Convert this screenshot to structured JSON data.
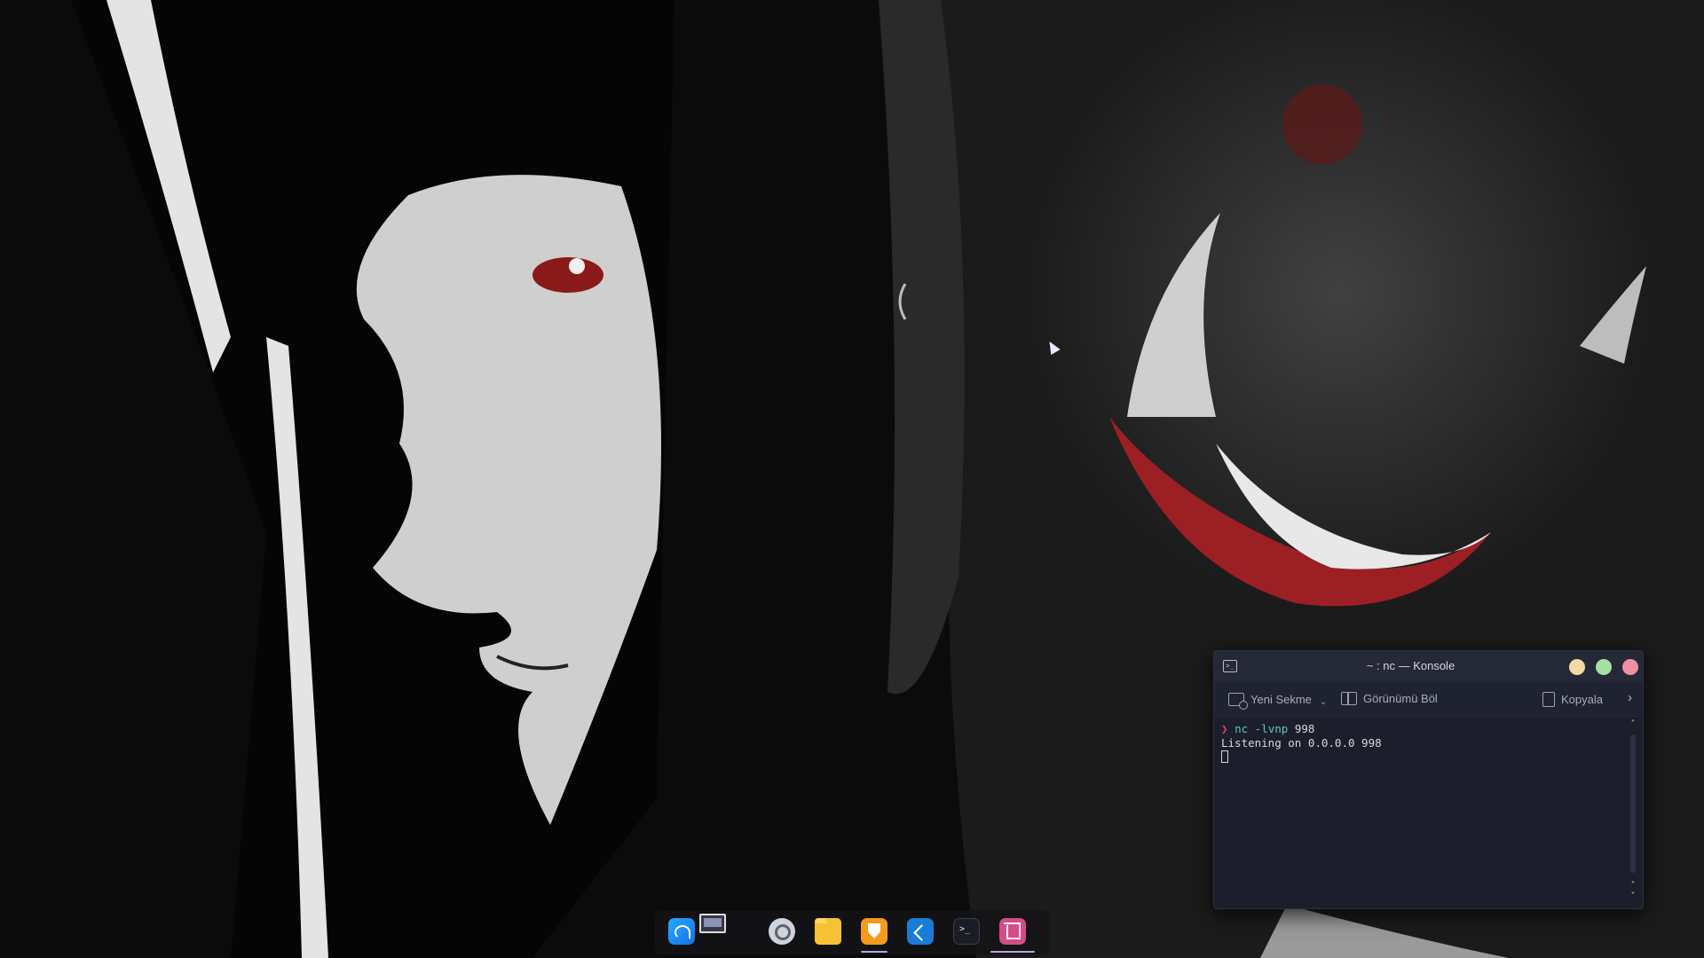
{
  "konsole": {
    "title": "~ : nc — Konsole",
    "toolbar": {
      "new_tab": "Yeni Sekme",
      "split_view": "Görünümü Böl",
      "copy": "Kopyala"
    },
    "terminal": {
      "prompt_symbol": "❯",
      "command": "nc -lvnp",
      "command_arg": "998",
      "output": "Listening on 0.0.0.0 998"
    }
  },
  "icons": {
    "terminal_app": "terminal-icon",
    "new_tab": "new-tab-icon",
    "split": "split-view-icon",
    "copy": "copy-icon",
    "more": "chevron-right-icon"
  },
  "dock": {
    "items": [
      {
        "name": "launcher"
      },
      {
        "name": "desktop-pager"
      },
      {
        "name": "system-settings"
      },
      {
        "name": "file-manager"
      },
      {
        "name": "brave-browser"
      },
      {
        "name": "vscode"
      },
      {
        "name": "konsole",
        "label": ">_"
      },
      {
        "name": "screenshot-tool"
      }
    ]
  },
  "colors": {
    "window_bg": "#1c1f2b",
    "minimize": "#f5d9a4",
    "maximize": "#a6dfa1",
    "close": "#f08fa3",
    "prompt": "#e0434d",
    "command": "#5cc9b8"
  }
}
